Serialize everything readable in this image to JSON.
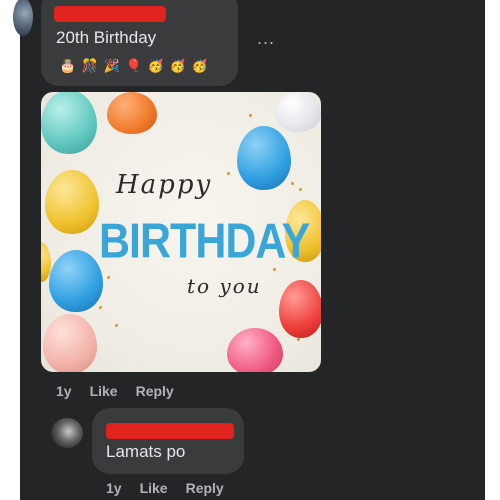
{
  "comment1": {
    "text": "20th Birthday",
    "emojis": [
      "🎂",
      "🎊",
      "🎉",
      "🎈",
      "🥳",
      "🥳",
      "🥳"
    ],
    "more": "...",
    "actions": {
      "time": "1y",
      "like": "Like",
      "reply": "Reply"
    }
  },
  "card": {
    "line1": "Happy",
    "line2": "BIRTHDAY",
    "line3": "to you",
    "accent_color": "#3aa6d8"
  },
  "reply": {
    "text": "Lamats po",
    "actions": {
      "time": "1y",
      "like": "Like",
      "reply": "Reply"
    }
  }
}
